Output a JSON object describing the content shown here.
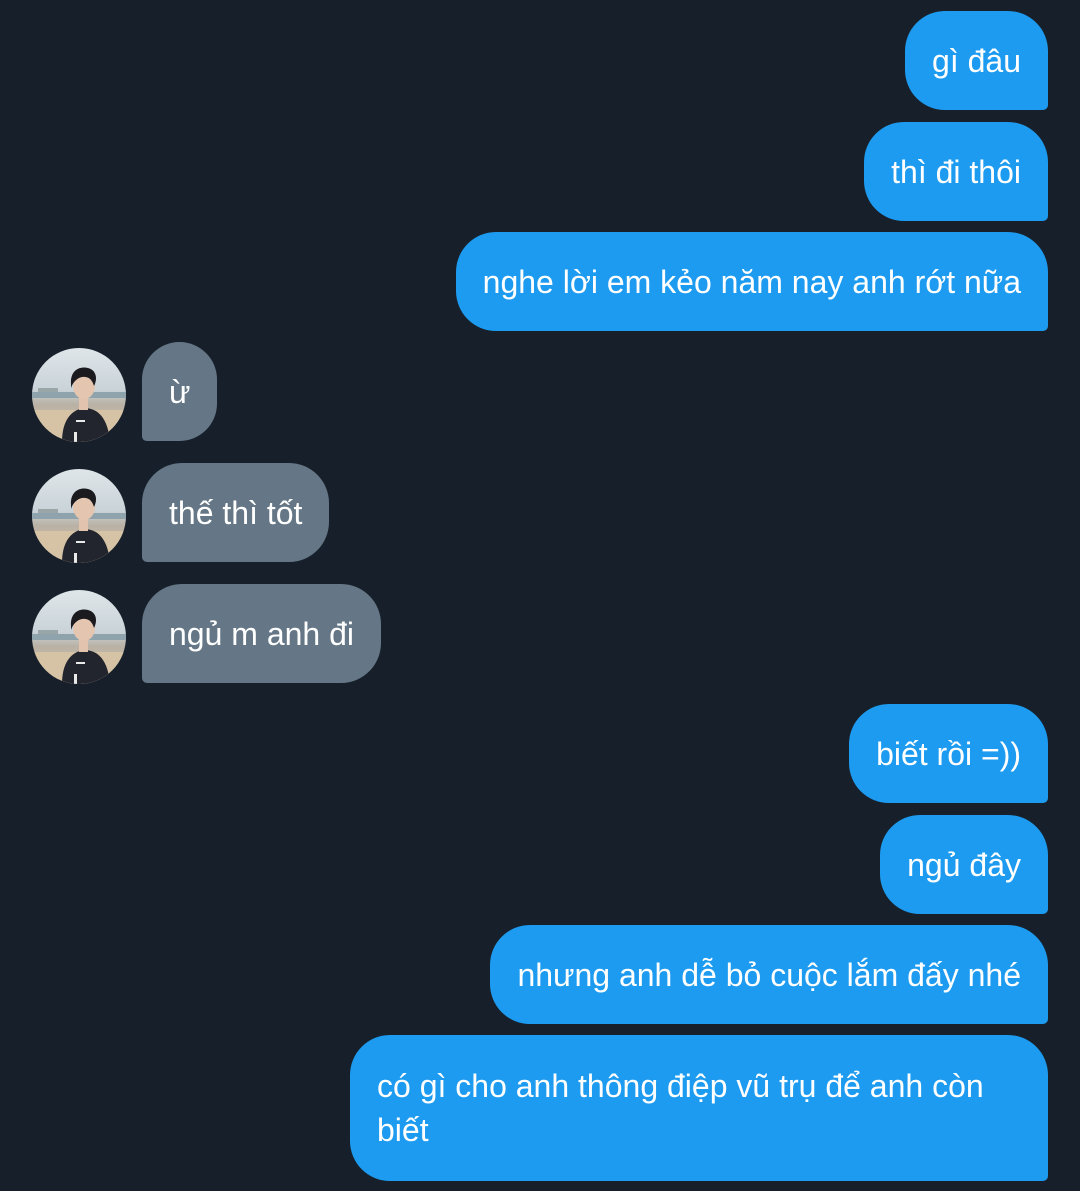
{
  "messages": [
    {
      "direction": "outgoing",
      "text": "gì đâu"
    },
    {
      "direction": "outgoing",
      "text": "thì đi thôi"
    },
    {
      "direction": "outgoing",
      "text": "nghe lời em kẻo năm nay anh rớt nữa"
    },
    {
      "direction": "incoming",
      "text": "ừ",
      "avatar": "contact-avatar"
    },
    {
      "direction": "incoming",
      "text": "thế thì tốt",
      "avatar": "contact-avatar"
    },
    {
      "direction": "incoming",
      "text": "ngủ m anh đi",
      "avatar": "contact-avatar"
    },
    {
      "direction": "outgoing",
      "text": "biết rồi =))"
    },
    {
      "direction": "outgoing",
      "text": "ngủ đây"
    },
    {
      "direction": "outgoing",
      "text": "nhưng anh dễ bỏ cuộc lắm đấy nhé"
    },
    {
      "direction": "outgoing",
      "text": "có gì cho anh thông điệp vũ trụ để anh còn biết"
    }
  ],
  "colors": {
    "background": "#17202a",
    "outgoing_bubble": "#1d9bf0",
    "incoming_bubble": "#657786",
    "text": "#ffffff"
  }
}
